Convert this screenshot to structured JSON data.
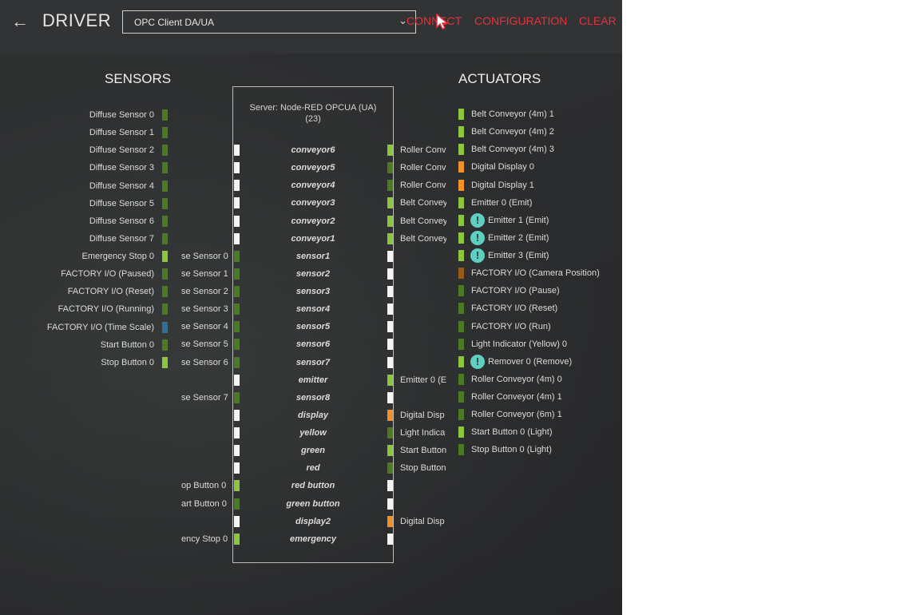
{
  "header": {
    "back_icon": "arrow-left-icon",
    "title": "DRIVER",
    "driver_select": "OPC Client DA/UA",
    "connect": "CONNECT",
    "configuration": "CONFIGURATION",
    "clear": "CLEAR"
  },
  "colors": {
    "bright_green": "#8cc63f",
    "dark_green": "#4a7a22",
    "orange": "#f0922b",
    "brown": "#9a5a18",
    "blue": "#2f6f96",
    "white": "#f4f4f4",
    "accent_red": "#e5323c"
  },
  "sensors": {
    "heading": "SENSORS",
    "items": [
      {
        "label": "Diffuse Sensor 0",
        "color": "dark_green"
      },
      {
        "label": "Diffuse Sensor 1",
        "color": "dark_green"
      },
      {
        "label": "Diffuse Sensor 2",
        "color": "dark_green"
      },
      {
        "label": "Diffuse Sensor 3",
        "color": "dark_green"
      },
      {
        "label": "Diffuse Sensor 4",
        "color": "dark_green"
      },
      {
        "label": "Diffuse Sensor 5",
        "color": "dark_green"
      },
      {
        "label": "Diffuse Sensor 6",
        "color": "dark_green"
      },
      {
        "label": "Diffuse Sensor 7",
        "color": "dark_green"
      },
      {
        "label": "Emergency Stop 0",
        "color": "bright_green"
      },
      {
        "label": "FACTORY I/O (Paused)",
        "color": "dark_green"
      },
      {
        "label": "FACTORY I/O (Reset)",
        "color": "dark_green"
      },
      {
        "label": "FACTORY I/O (Running)",
        "color": "dark_green"
      },
      {
        "label": "FACTORY I/O (Time Scale)",
        "color": "blue"
      },
      {
        "label": "Start Button 0",
        "color": "dark_green"
      },
      {
        "label": "Stop Button 0",
        "color": "bright_green"
      }
    ]
  },
  "actuators": {
    "heading": "ACTUATORS",
    "items": [
      {
        "label": "Belt Conveyor (4m) 1",
        "color": "bright_green",
        "warn": false
      },
      {
        "label": "Belt Conveyor (4m) 2",
        "color": "bright_green",
        "warn": false
      },
      {
        "label": "Belt Conveyor (4m) 3",
        "color": "bright_green",
        "warn": false
      },
      {
        "label": "Digital Display 0",
        "color": "orange",
        "warn": false
      },
      {
        "label": "Digital Display 1",
        "color": "orange",
        "warn": false
      },
      {
        "label": "Emitter 0 (Emit)",
        "color": "bright_green",
        "warn": false
      },
      {
        "label": "Emitter 1 (Emit)",
        "color": "bright_green",
        "warn": true
      },
      {
        "label": "Emitter 2 (Emit)",
        "color": "bright_green",
        "warn": true
      },
      {
        "label": "Emitter 3 (Emit)",
        "color": "bright_green",
        "warn": true
      },
      {
        "label": "FACTORY I/O (Camera Position)",
        "color": "brown",
        "warn": false
      },
      {
        "label": "FACTORY I/O (Pause)",
        "color": "dark_green",
        "warn": false
      },
      {
        "label": "FACTORY I/O (Reset)",
        "color": "dark_green",
        "warn": false
      },
      {
        "label": "FACTORY I/O (Run)",
        "color": "dark_green",
        "warn": false
      },
      {
        "label": "Light Indicator (Yellow) 0",
        "color": "dark_green",
        "warn": false
      },
      {
        "label": "Remover 0 (Remove)",
        "color": "bright_green",
        "warn": true
      },
      {
        "label": "Roller Conveyor (4m) 0",
        "color": "dark_green",
        "warn": false
      },
      {
        "label": "Roller Conveyor (4m) 1",
        "color": "dark_green",
        "warn": false
      },
      {
        "label": "Roller Conveyor (6m) 1",
        "color": "dark_green",
        "warn": false
      },
      {
        "label": "Start Button 0 (Light)",
        "color": "bright_green",
        "warn": false
      },
      {
        "label": "Stop Button 0 (Light)",
        "color": "dark_green",
        "warn": false
      }
    ]
  },
  "server": {
    "label_line1": "Server: Node-RED OPCUA (UA)",
    "label_line2": "(23)",
    "tags": [
      {
        "name": "conveyor6",
        "left": "",
        "left_color": "white",
        "right": "Roller Conve",
        "right_color": "bright_green"
      },
      {
        "name": "conveyor5",
        "left": "",
        "left_color": "white",
        "right": "Roller Conve",
        "right_color": "dark_green"
      },
      {
        "name": "conveyor4",
        "left": "",
        "left_color": "white",
        "right": "Roller Conve",
        "right_color": "dark_green"
      },
      {
        "name": "conveyor3",
        "left": "",
        "left_color": "white",
        "right": "Belt Convey",
        "right_color": "bright_green"
      },
      {
        "name": "conveyor2",
        "left": "",
        "left_color": "white",
        "right": "Belt Convey",
        "right_color": "bright_green"
      },
      {
        "name": "conveyor1",
        "left": "",
        "left_color": "white",
        "right": "Belt Convey",
        "right_color": "bright_green"
      },
      {
        "name": "sensor1",
        "left": "se Sensor 0",
        "left_color": "dark_green",
        "right": "",
        "right_color": "white"
      },
      {
        "name": "sensor2",
        "left": "se Sensor 1",
        "left_color": "dark_green",
        "right": "",
        "right_color": "white"
      },
      {
        "name": "sensor3",
        "left": "se Sensor 2",
        "left_color": "dark_green",
        "right": "",
        "right_color": "white"
      },
      {
        "name": "sensor4",
        "left": "se Sensor 3",
        "left_color": "dark_green",
        "right": "",
        "right_color": "white"
      },
      {
        "name": "sensor5",
        "left": "se Sensor 4",
        "left_color": "dark_green",
        "right": "",
        "right_color": "white"
      },
      {
        "name": "sensor6",
        "left": "se Sensor 5",
        "left_color": "dark_green",
        "right": "",
        "right_color": "white"
      },
      {
        "name": "sensor7",
        "left": "se Sensor 6",
        "left_color": "dark_green",
        "right": "",
        "right_color": "white"
      },
      {
        "name": "emitter",
        "left": "",
        "left_color": "white",
        "right": "Emitter 0 (E",
        "right_color": "bright_green"
      },
      {
        "name": "sensor8",
        "left": "se Sensor 7",
        "left_color": "dark_green",
        "right": "",
        "right_color": "white"
      },
      {
        "name": "display",
        "left": "",
        "left_color": "white",
        "right": "Digital Disp",
        "right_color": "orange"
      },
      {
        "name": "yellow",
        "left": "",
        "left_color": "white",
        "right": "Light Indica",
        "right_color": "dark_green"
      },
      {
        "name": "green",
        "left": "",
        "left_color": "white",
        "right": "Start Button",
        "right_color": "bright_green"
      },
      {
        "name": "red",
        "left": "",
        "left_color": "white",
        "right": "Stop Button",
        "right_color": "dark_green"
      },
      {
        "name": "red button",
        "left": "op Button 0",
        "left_color": "bright_green",
        "right": "",
        "right_color": "white"
      },
      {
        "name": "green button",
        "left": "art Button 0",
        "left_color": "dark_green",
        "right": "",
        "right_color": "white"
      },
      {
        "name": "display2",
        "left": "",
        "left_color": "white",
        "right": "Digital Disp",
        "right_color": "orange"
      },
      {
        "name": "emergency",
        "left": "ency Stop 0",
        "left_color": "bright_green",
        "right": "",
        "right_color": "white"
      }
    ]
  }
}
